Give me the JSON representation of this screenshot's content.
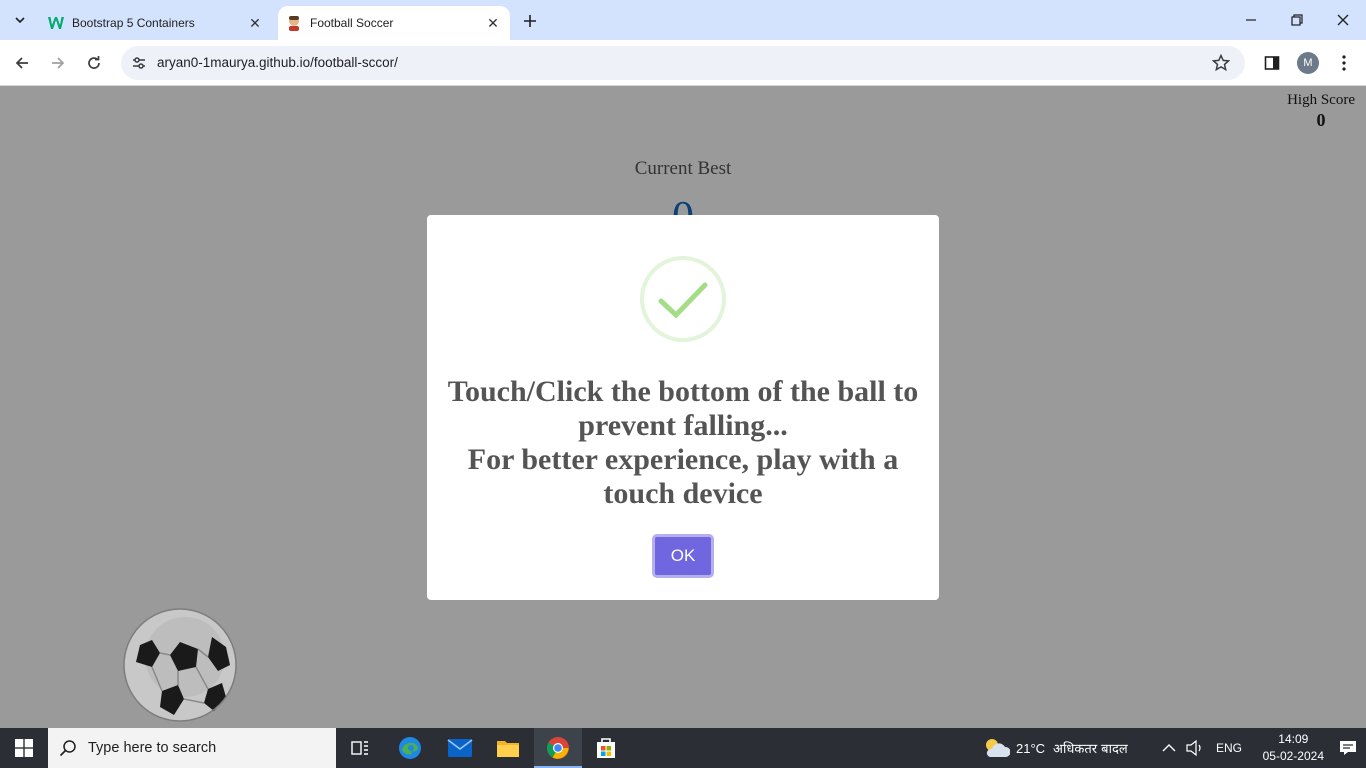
{
  "browser": {
    "tabs": [
      {
        "title": "Bootstrap 5 Containers",
        "active": false,
        "favicon": "w3schools-icon"
      },
      {
        "title": "Football Soccer",
        "active": true,
        "favicon": "football-player-icon"
      }
    ],
    "url": "aryan0-1maurya.github.io/football-sccor/",
    "profile_initial": "M"
  },
  "page": {
    "high_score_label": "High Score",
    "high_score_value": "0",
    "current_best_label": "Current Best",
    "current_best_value": "0"
  },
  "modal": {
    "message_line1": "Touch/Click the bottom of the ball to prevent falling...",
    "message_line2": "For better experience, play with a touch device",
    "ok_label": "OK",
    "icon": "success-check-icon"
  },
  "taskbar": {
    "search_placeholder": "Type here to search",
    "weather": "21°C",
    "weather_text": "अधिकतर बादल",
    "language": "ENG",
    "time": "14:09",
    "date": "05-02-2024"
  },
  "colors": {
    "overlay": "#9a9a9a",
    "ok_button": "#7066e0",
    "check": "#a5dc86",
    "tabbar": "#d3e3fd",
    "taskbar": "#2b2f35"
  }
}
